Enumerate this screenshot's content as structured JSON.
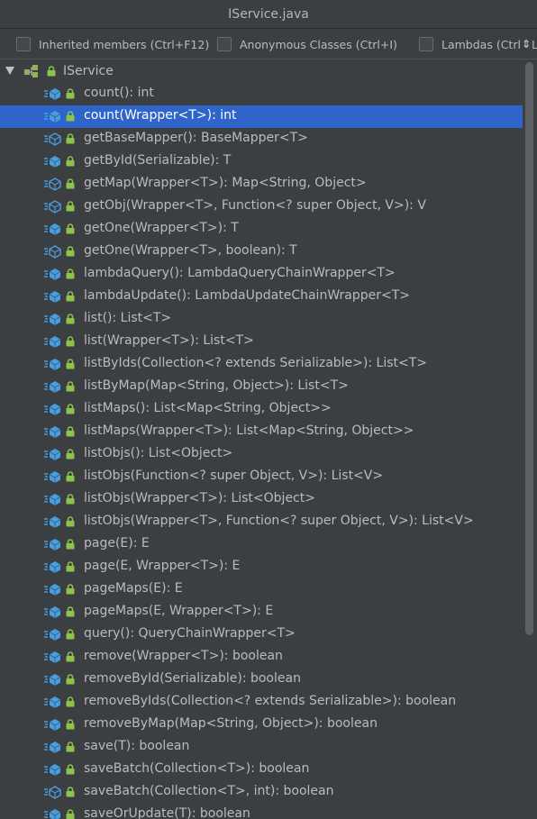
{
  "window": {
    "title": "IService.java"
  },
  "options": [
    {
      "label": "Inherited members (Ctrl+F12)",
      "checked": false
    },
    {
      "label": "Anonymous Classes (Ctrl+I)",
      "checked": false
    },
    {
      "label_pre": "Lambdas (Ctrl",
      "label_post": "L)",
      "checked": false
    }
  ],
  "tree": {
    "root": {
      "label": "IService",
      "expanded": true
    },
    "selected_index": 1,
    "methods": [
      {
        "label": "count(): int",
        "icon": "method-icon"
      },
      {
        "label": "count(Wrapper<T>): int",
        "icon": "method-icon"
      },
      {
        "label": "getBaseMapper(): BaseMapper<T>",
        "icon": "abstract-method-icon"
      },
      {
        "label": "getById(Serializable): T",
        "icon": "method-icon"
      },
      {
        "label": "getMap(Wrapper<T>): Map<String, Object>",
        "icon": "abstract-method-icon"
      },
      {
        "label": "getObj(Wrapper<T>, Function<? super Object, V>): V",
        "icon": "abstract-method-icon"
      },
      {
        "label": "getOne(Wrapper<T>): T",
        "icon": "method-icon"
      },
      {
        "label": "getOne(Wrapper<T>, boolean): T",
        "icon": "abstract-method-icon"
      },
      {
        "label": "lambdaQuery(): LambdaQueryChainWrapper<T>",
        "icon": "method-icon"
      },
      {
        "label": "lambdaUpdate(): LambdaUpdateChainWrapper<T>",
        "icon": "method-icon"
      },
      {
        "label": "list(): List<T>",
        "icon": "method-icon"
      },
      {
        "label": "list(Wrapper<T>): List<T>",
        "icon": "method-icon"
      },
      {
        "label": "listByIds(Collection<? extends Serializable>): List<T>",
        "icon": "method-icon"
      },
      {
        "label": "listByMap(Map<String, Object>): List<T>",
        "icon": "method-icon"
      },
      {
        "label": "listMaps(): List<Map<String, Object>>",
        "icon": "method-icon"
      },
      {
        "label": "listMaps(Wrapper<T>): List<Map<String, Object>>",
        "icon": "method-icon"
      },
      {
        "label": "listObjs(): List<Object>",
        "icon": "method-icon"
      },
      {
        "label": "listObjs(Function<? super Object, V>): List<V>",
        "icon": "method-icon"
      },
      {
        "label": "listObjs(Wrapper<T>): List<Object>",
        "icon": "method-icon"
      },
      {
        "label": "listObjs(Wrapper<T>, Function<? super Object, V>): List<V>",
        "icon": "method-icon"
      },
      {
        "label": "page(E): E",
        "icon": "method-icon"
      },
      {
        "label": "page(E, Wrapper<T>): E",
        "icon": "method-icon"
      },
      {
        "label": "pageMaps(E): E",
        "icon": "method-icon"
      },
      {
        "label": "pageMaps(E, Wrapper<T>): E",
        "icon": "method-icon"
      },
      {
        "label": "query(): QueryChainWrapper<T>",
        "icon": "method-icon"
      },
      {
        "label": "remove(Wrapper<T>): boolean",
        "icon": "method-icon"
      },
      {
        "label": "removeById(Serializable): boolean",
        "icon": "method-icon"
      },
      {
        "label": "removeByIds(Collection<? extends Serializable>): boolean",
        "icon": "method-icon"
      },
      {
        "label": "removeByMap(Map<String, Object>): boolean",
        "icon": "method-icon"
      },
      {
        "label": "save(T): boolean",
        "icon": "method-icon"
      },
      {
        "label": "saveBatch(Collection<T>): boolean",
        "icon": "method-icon"
      },
      {
        "label": "saveBatch(Collection<T>, int): boolean",
        "icon": "abstract-method-icon"
      },
      {
        "label": "saveOrUpdate(T): boolean",
        "icon": "method-icon"
      }
    ]
  },
  "colors": {
    "background": "#3c3f41",
    "selection": "#2f65ca",
    "method_icon": "#4a9ede",
    "lock": "#8cc34b",
    "text": "#bbbbbb"
  }
}
